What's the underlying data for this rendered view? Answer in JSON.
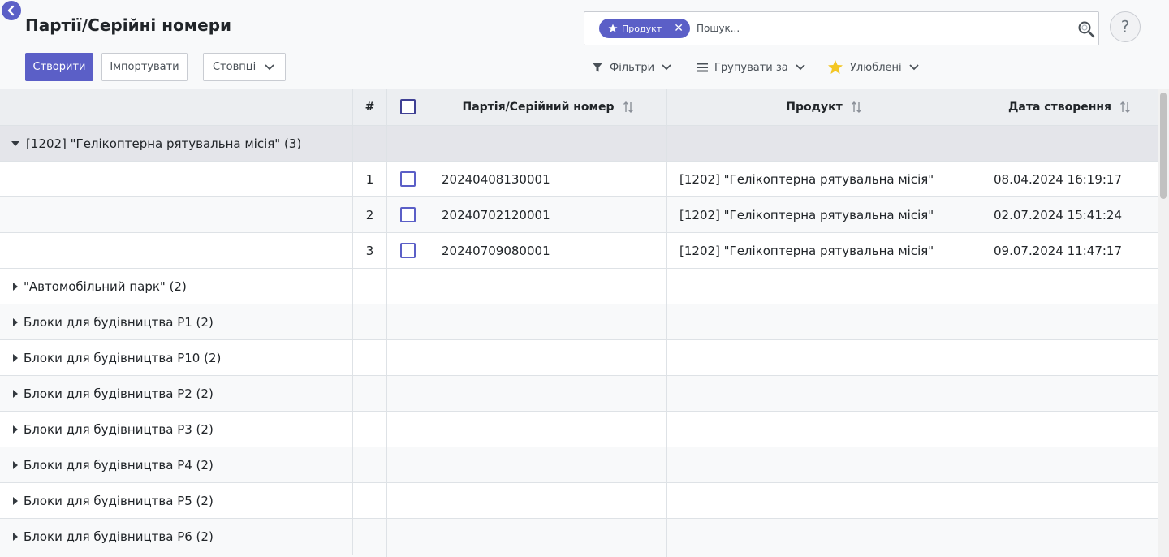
{
  "header": {
    "title": "Партії/Серійні номери",
    "create_label": "Створити",
    "import_label": "Імпортувати",
    "columns_label": "Стовпці"
  },
  "search": {
    "facet_label": "Продукт",
    "placeholder": "Пошук...",
    "help_label": "?"
  },
  "controls": {
    "filters_label": "Фільтри",
    "group_by_label": "Групувати за",
    "favorites_label": "Улюблені"
  },
  "colors": {
    "accent": "#5b5fc7",
    "favorite_star": "#f3c623"
  },
  "table": {
    "columns": {
      "number": "#",
      "lot": "Партія/Серійний номер",
      "product": "Продукт",
      "created": "Дата створення"
    },
    "expanded_group": {
      "label": "[1202] \"Гелікоптерна рятувальна місія\" (3)",
      "rows": [
        {
          "n": "1",
          "lot": "20240408130001",
          "product": "[1202] \"Гелікоптерна рятувальна місія\"",
          "created": "08.04.2024 16:19:17"
        },
        {
          "n": "2",
          "lot": "20240702120001",
          "product": "[1202] \"Гелікоптерна рятувальна місія\"",
          "created": "02.07.2024 15:41:24"
        },
        {
          "n": "3",
          "lot": "20240709080001",
          "product": "[1202] \"Гелікоптерна рятувальна місія\"",
          "created": "09.07.2024 11:47:17"
        }
      ]
    },
    "groups": [
      {
        "label": "\"Автомобільний парк\" (2)"
      },
      {
        "label": "Блоки для будівництва P1 (2)"
      },
      {
        "label": "Блоки для будівництва P10 (2)"
      },
      {
        "label": "Блоки для будівництва P2 (2)"
      },
      {
        "label": "Блоки для будівництва P3 (2)"
      },
      {
        "label": "Блоки для будівництва P4 (2)"
      },
      {
        "label": "Блоки для будівництва P5 (2)"
      },
      {
        "label": "Блоки для будівництва P6 (2)"
      }
    ]
  }
}
